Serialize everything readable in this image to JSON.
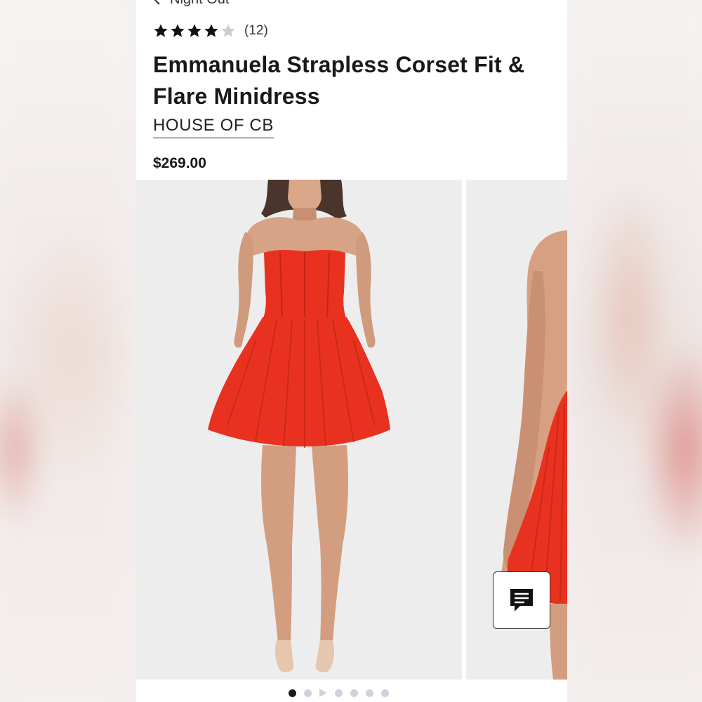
{
  "nav": {
    "back_label": "Night Out"
  },
  "rating": {
    "value": 4,
    "max": 5,
    "count_label": "(12)"
  },
  "product": {
    "title": "Emmanuela Strapless Corset Fit & Flare Minidress",
    "brand": "HOUSE OF CB",
    "price": "$269.00"
  },
  "gallery": {
    "image_count": 7,
    "active_index": 0,
    "video_index": 2
  },
  "colors": {
    "dress": "#e8321f",
    "photo_bg": "#ededee",
    "dot_active": "#1a1a1a",
    "dot_inactive": "#cdd3dd"
  },
  "icons": {
    "back": "chevron-left-icon",
    "star_filled": "star-filled-icon",
    "star_empty": "star-empty-icon",
    "chat": "chat-icon",
    "video": "play-icon"
  }
}
